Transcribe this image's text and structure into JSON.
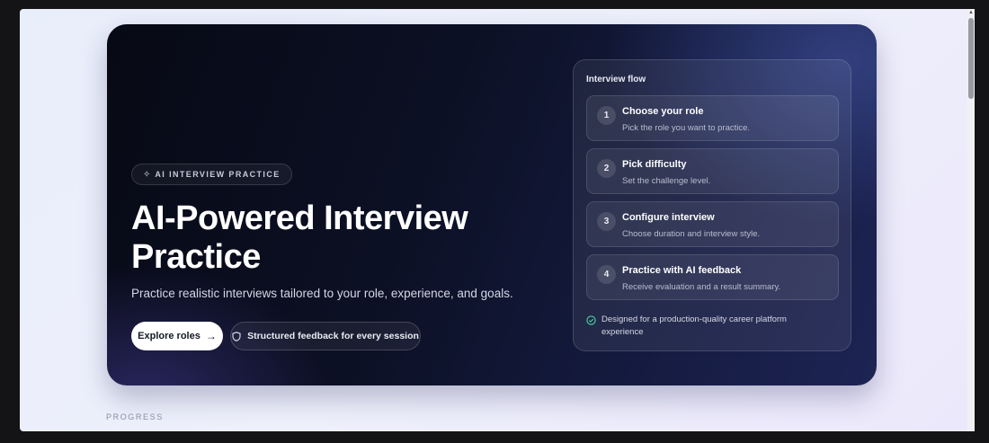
{
  "hero": {
    "eyebrow": "AI INTERVIEW PRACTICE",
    "title": "AI-Powered Interview Practice",
    "subtitle": "Practice realistic interviews tailored to your role, experience, and goals.",
    "primary_button": "Explore roles",
    "secondary_button": "Structured feedback for every session"
  },
  "flow": {
    "title": "Interview flow",
    "steps": [
      {
        "number": "1",
        "title": "Choose your role",
        "description": "Pick the role you want to practice."
      },
      {
        "number": "2",
        "title": "Pick difficulty",
        "description": "Set the challenge level."
      },
      {
        "number": "3",
        "title": "Configure interview",
        "description": "Choose duration and interview style."
      },
      {
        "number": "4",
        "title": "Practice with AI feedback",
        "description": "Receive evaluation and a result summary."
      }
    ],
    "note": "Designed for a production-quality career platform experience"
  },
  "progress": {
    "label": "PROGRESS"
  },
  "icons": {
    "eyebrow": "sparkle-icon",
    "primary_button": "arrow-right-icon",
    "secondary_button": "shield-icon",
    "note": "check-circle-icon"
  },
  "colors": {
    "hero_bg": "#0c1024",
    "hero_accent": "#1d2453",
    "check_green": "#4fd1a5",
    "primary_button_bg": "#ffffff"
  }
}
